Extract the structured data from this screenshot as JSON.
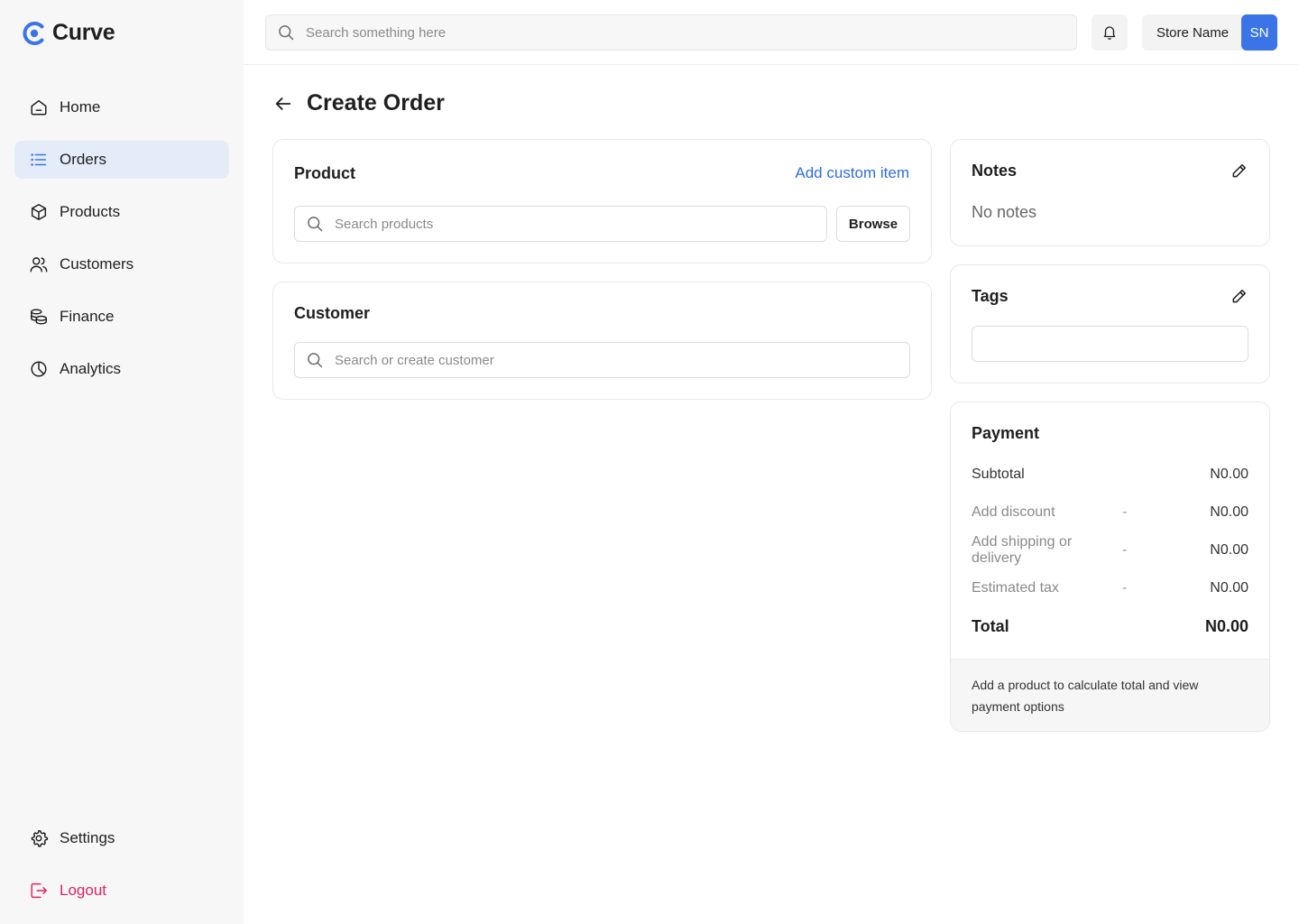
{
  "app": {
    "name": "Curve"
  },
  "sidebar": {
    "items": [
      {
        "label": "Home",
        "icon": "home-icon"
      },
      {
        "label": "Orders",
        "icon": "list-icon",
        "active": true
      },
      {
        "label": "Products",
        "icon": "box-icon"
      },
      {
        "label": "Customers",
        "icon": "users-icon"
      },
      {
        "label": "Finance",
        "icon": "coins-icon"
      },
      {
        "label": "Analytics",
        "icon": "pie-chart-icon"
      }
    ],
    "bottom": [
      {
        "label": "Settings",
        "icon": "gear-icon"
      },
      {
        "label": "Logout",
        "icon": "logout-icon"
      }
    ]
  },
  "topbar": {
    "search_placeholder": "Search something here",
    "store_name": "Store Name",
    "avatar_initials": "SN"
  },
  "page": {
    "title": "Create Order"
  },
  "product_card": {
    "title": "Product",
    "add_custom_label": "Add custom item",
    "search_placeholder": "Search products",
    "browse_label": "Browse"
  },
  "customer_card": {
    "title": "Customer",
    "search_placeholder": "Search or create customer"
  },
  "notes_card": {
    "title": "Notes",
    "body": "No notes"
  },
  "tags_card": {
    "title": "Tags",
    "value": ""
  },
  "payment_card": {
    "title": "Payment",
    "rows": [
      {
        "label": "Subtotal",
        "dash": "",
        "value": "N0.00"
      },
      {
        "label": "Add discount",
        "dash": "-",
        "value": "N0.00"
      },
      {
        "label": "Add shipping or delivery",
        "dash": "-",
        "value": "N0.00"
      },
      {
        "label": "Estimated tax",
        "dash": "-",
        "value": "N0.00"
      }
    ],
    "total_label": "Total",
    "total_value": "N0.00",
    "footer": "Add a product to calculate total and view payment options"
  },
  "colors": {
    "accent": "#3b74e6",
    "active_bg": "#e4ecf9",
    "logout": "#e0245e",
    "link": "#2f6ee0"
  }
}
